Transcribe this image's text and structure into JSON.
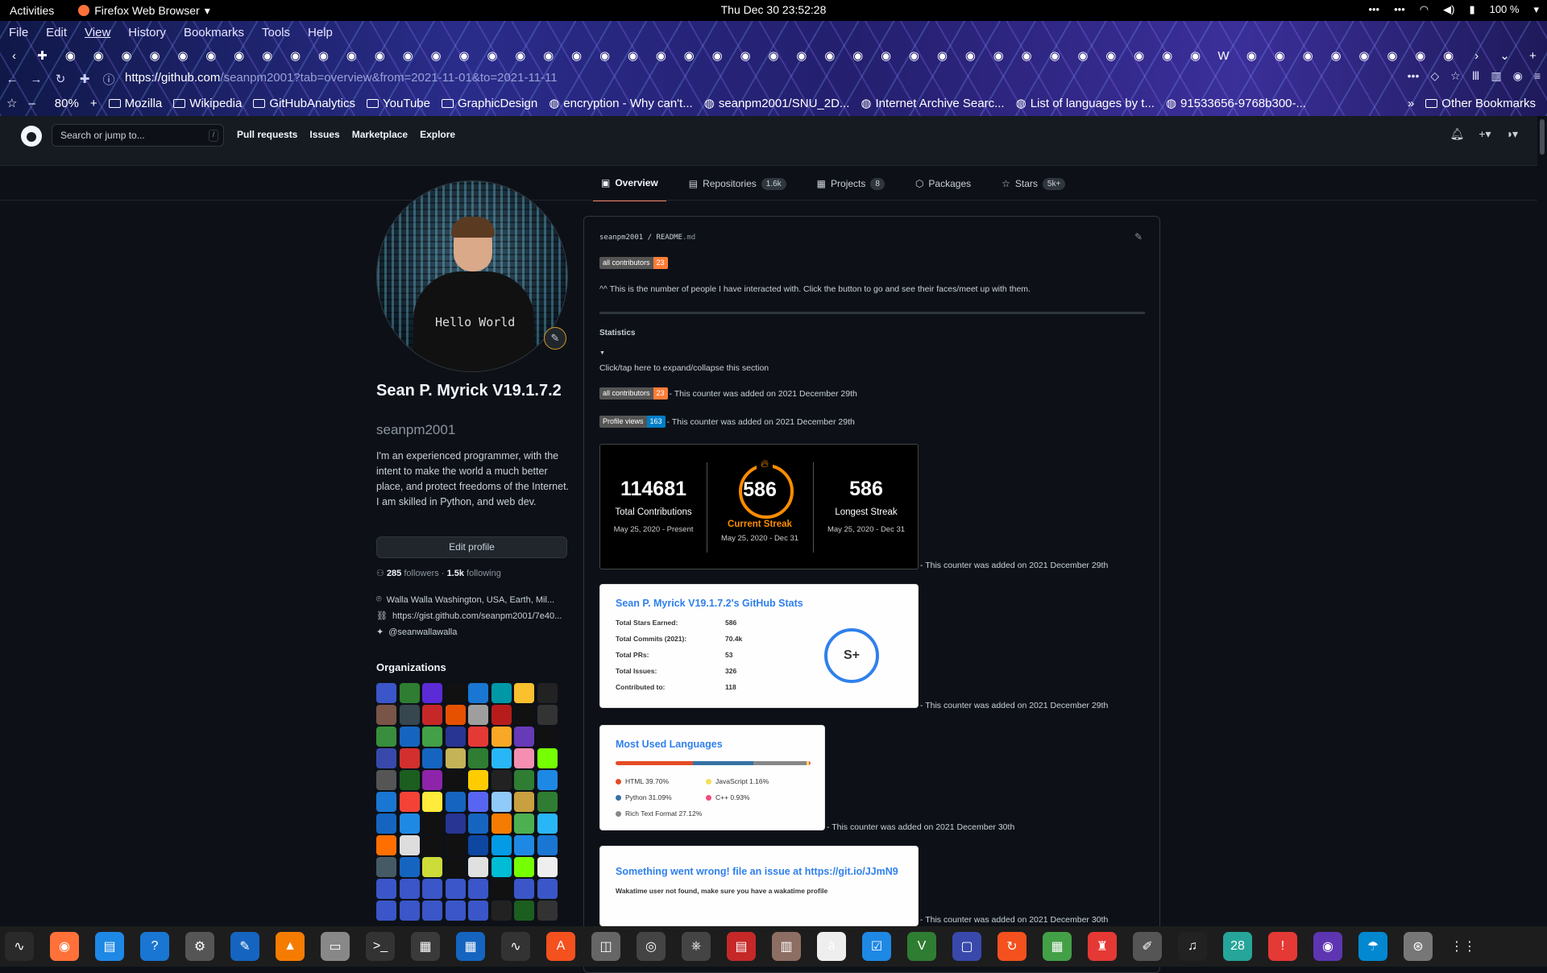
{
  "system": {
    "activities": "Activities",
    "app_name": "Firefox Web Browser",
    "clock": "Thu Dec 30  23:52:28",
    "battery": "100 %"
  },
  "browser": {
    "menu": [
      "File",
      "Edit",
      "View",
      "History",
      "Bookmarks",
      "Tools",
      "Help"
    ],
    "url_host": "https://github.com",
    "url_path": "/seanpm2001?tab=overview&from=2021-11-01&to=2021-11-11",
    "zoom": "80%",
    "bookmarks": [
      {
        "label": "Mozilla",
        "icon": "folder-icon"
      },
      {
        "label": "Wikipedia",
        "icon": "folder-icon"
      },
      {
        "label": "GitHubAnalytics",
        "icon": "folder-icon"
      },
      {
        "label": "YouTube",
        "icon": "folder-icon"
      },
      {
        "label": "GraphicDesign",
        "icon": "folder-icon"
      },
      {
        "label": "encryption - Why can't...",
        "icon": "stackexchange-icon"
      },
      {
        "label": "seanpm2001/SNU_2D...",
        "icon": "github-icon"
      },
      {
        "label": "Internet Archive Searc...",
        "icon": "archive-icon"
      },
      {
        "label": "List of languages by t...",
        "icon": "wikipedia-icon"
      },
      {
        "label": "91533656-9768b300-...",
        "icon": "globe-icon"
      }
    ],
    "other_bookmarks": "Other Bookmarks"
  },
  "github": {
    "search_placeholder": "Search or jump to...",
    "nav": [
      "Pull requests",
      "Issues",
      "Marketplace",
      "Explore"
    ],
    "tabs": [
      {
        "label": "Overview",
        "count": ""
      },
      {
        "label": "Repositories",
        "count": "1.6k"
      },
      {
        "label": "Projects",
        "count": "8"
      },
      {
        "label": "Packages",
        "count": ""
      },
      {
        "label": "Stars",
        "count": "5k+"
      }
    ]
  },
  "profile": {
    "name": "Sean P. Myrick V19.1.7.2",
    "login": "seanpm2001",
    "bio": "I'm an experienced programmer, with the intent to make the world a much better place, and protect freedoms of the Internet. I am skilled in Python, and web dev.",
    "edit_button": "Edit profile",
    "followers": "285",
    "followers_label": "followers",
    "separator": "·",
    "following": "1.5k",
    "following_label": "following",
    "location": "Walla Walla Washington, USA, Earth, Mil...",
    "website": "https://gist.github.com/seanpm2001/7e40...",
    "twitter": "@seanwallawalla",
    "organizations_title": "Organizations",
    "avatar_shirt_text": "Hello World"
  },
  "readme": {
    "path_user": "seanpm2001",
    "path_sep": "/",
    "path_file": "README",
    "path_ext": ".md",
    "contributors_badge_label": "all contributors",
    "contributors_badge_value": "23",
    "contributors_badge_color": "#fe7d37",
    "note": "^^ This is the number of people I have interacted with. Click the button to go and see their faces/meet up with them.",
    "statistics_title": "Statistics",
    "expand_text": "Click/tap here to expand/collapse this section",
    "added_dec29": "- This counter was added on 2021 December 29th",
    "added_dec30": "- This counter was added on 2021 December 30th",
    "views_badge_label": "Profile views",
    "views_badge_value": "163",
    "views_badge_color": "#007ec6"
  },
  "streak": {
    "total": "114681",
    "total_label": "Total Contributions",
    "total_range": "May 25, 2020 - Present",
    "current": "586",
    "current_label": "Current Streak",
    "current_range": "May 25, 2020 - Dec 31",
    "longest": "586",
    "longest_label": "Longest Streak",
    "longest_range": "May 25, 2020 - Dec 31"
  },
  "stats_card": {
    "title": "Sean P. Myrick V19.1.7.2's GitHub Stats",
    "rows": [
      {
        "label": "Total Stars Earned:",
        "value": "586"
      },
      {
        "label": "Total Commits (2021):",
        "value": "70.4k"
      },
      {
        "label": "Total PRs:",
        "value": "53"
      },
      {
        "label": "Total Issues:",
        "value": "326"
      },
      {
        "label": "Contributed to:",
        "value": "118"
      }
    ],
    "rank": "S+"
  },
  "languages_card": {
    "title": "Most Used Languages",
    "items": [
      {
        "label": "HTML 39.70%",
        "percent": 39.7,
        "color": "#e34c26"
      },
      {
        "label": "JavaScript 1.16%",
        "percent": 1.16,
        "color": "#f1e05a"
      },
      {
        "label": "Python 31.09%",
        "percent": 31.09,
        "color": "#3572a5"
      },
      {
        "label": "C++ 0.93%",
        "percent": 0.93,
        "color": "#f34b7d"
      },
      {
        "label": "Rich Text Format 27.12%",
        "percent": 27.12,
        "color": "#888888"
      }
    ]
  },
  "wakatime_card": {
    "error": "Something went wrong! file an issue at https://git.io/JJmN9",
    "message": "Wakatime user not found, make sure you have a wakatime profile"
  }
}
